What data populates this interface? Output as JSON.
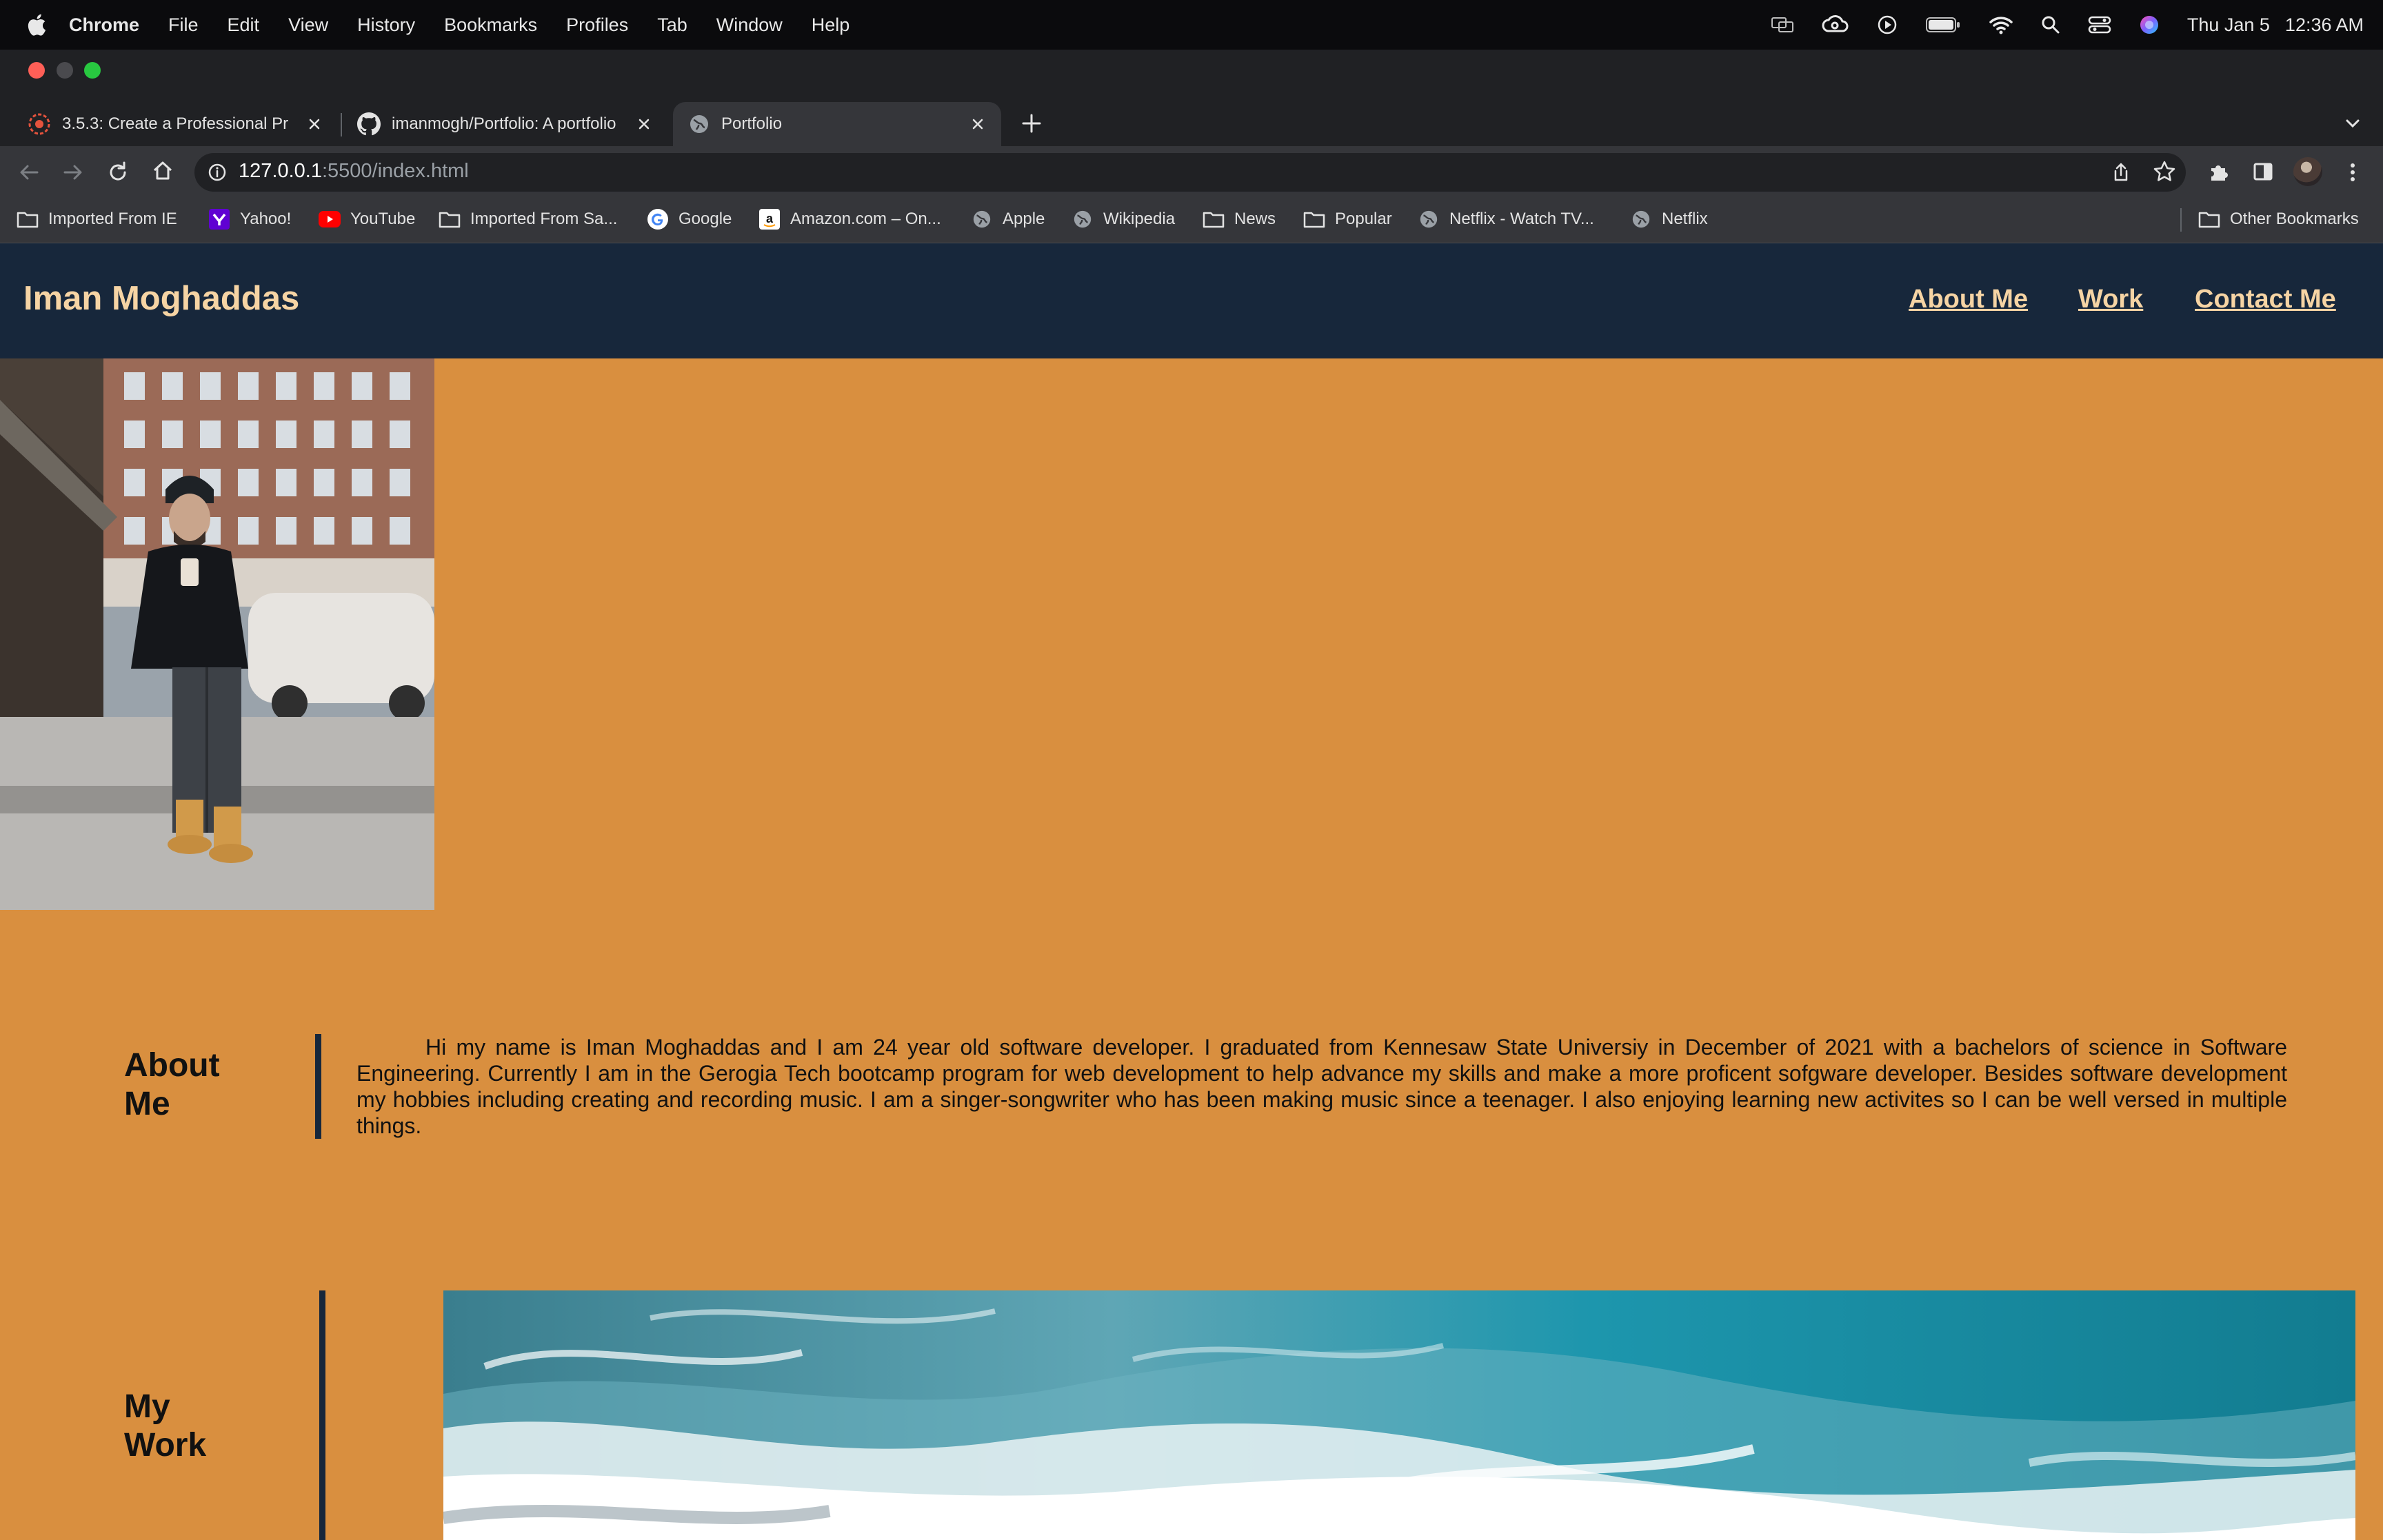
{
  "menubar": {
    "app": "Chrome",
    "items": [
      "File",
      "Edit",
      "View",
      "History",
      "Bookmarks",
      "Profiles",
      "Tab",
      "Window",
      "Help"
    ],
    "date": "Thu Jan 5",
    "time": "12:36 AM",
    "status_icons": [
      "screen-mirroring-icon",
      "creative-cloud-icon",
      "media-play-icon",
      "battery-icon",
      "wifi-icon",
      "spotlight-search-icon",
      "control-center-icon",
      "siri-icon"
    ]
  },
  "tabs": [
    {
      "title": "3.5.3: Create a Professional Pr",
      "icon": "bootcamp-logo-icon"
    },
    {
      "title": "imanmogh/Portfolio: A portfolio",
      "icon": "github-icon"
    },
    {
      "title": "Portfolio",
      "icon": "globe-icon"
    }
  ],
  "toolbar": {
    "url_host": "127.0.0.1",
    "url_rest": ":5500/index.html"
  },
  "bookmarks": [
    {
      "label": "Imported From IE",
      "icon": "folder-icon"
    },
    {
      "label": "Yahoo!",
      "icon": "yahoo-icon"
    },
    {
      "label": "YouTube",
      "icon": "youtube-icon"
    },
    {
      "label": "Imported From Sa...",
      "icon": "folder-icon"
    },
    {
      "label": "Google",
      "icon": "google-icon"
    },
    {
      "label": "Amazon.com – On...",
      "icon": "amazon-icon"
    },
    {
      "label": "Apple",
      "icon": "globe-icon"
    },
    {
      "label": "Wikipedia",
      "icon": "globe-icon"
    },
    {
      "label": "News",
      "icon": "folder-icon"
    },
    {
      "label": "Popular",
      "icon": "folder-icon"
    },
    {
      "label": "Netflix - Watch TV...",
      "icon": "globe-icon"
    },
    {
      "label": "Netflix",
      "icon": "globe-icon"
    }
  ],
  "other_bookmarks": "Other Bookmarks",
  "site": {
    "brand": "Iman Moghaddas",
    "nav": [
      "About Me",
      "Work",
      "Contact Me"
    ],
    "about_title": [
      "About",
      "Me"
    ],
    "about_text": "Hi my name is Iman Moghaddas and I am 24 year old software developer. I graduated from Kennesaw State Universiy in December of 2021 with a bachelors of science in Software Engineering. Currently I am in the Gerogia Tech bootcamp program for web development to help advance my skills and make a more proficent sofgware developer. Besides software development my hobbies including creating and recording music. I am a singer-songwriter who has been making music since a teenager. I also enjoying learning new activites so I can be well versed in multiple things.",
    "work_title": [
      "My",
      "Work"
    ]
  },
  "colors": {
    "page_bg": "#d98f3f",
    "header_bg": "#17273b",
    "header_text": "#f6d4a4"
  }
}
